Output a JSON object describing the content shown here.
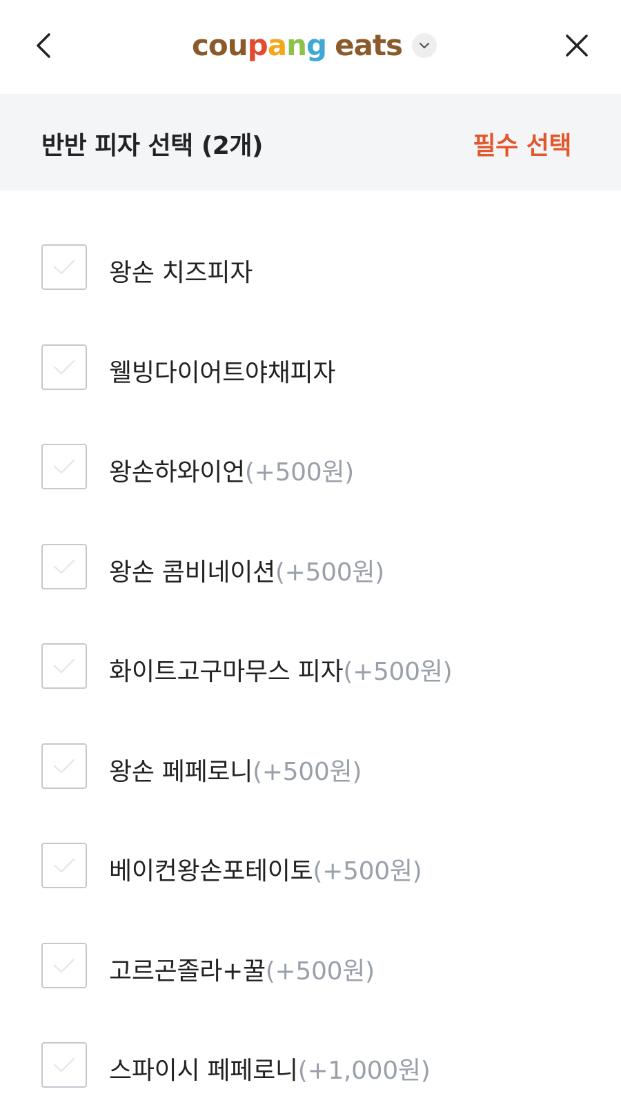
{
  "header": {
    "logo_letters": [
      {
        "char": "c",
        "color": "#8b5a2b"
      },
      {
        "char": "o",
        "color": "#8b5a2b"
      },
      {
        "char": "u",
        "color": "#8b5a2b"
      },
      {
        "char": "p",
        "color": "#e24b2f"
      },
      {
        "char": "a",
        "color": "#f2a81d"
      },
      {
        "char": "n",
        "color": "#8bc34a"
      },
      {
        "char": "g",
        "color": "#3fa9d6"
      },
      {
        "char": " ",
        "color": "#8b5a2b"
      },
      {
        "char": "e",
        "color": "#8b5a2b"
      },
      {
        "char": "a",
        "color": "#8b5a2b"
      },
      {
        "char": "t",
        "color": "#8b5a2b"
      },
      {
        "char": "s",
        "color": "#8b5a2b"
      }
    ],
    "back_icon": "chevron-left-icon",
    "close_icon": "close-icon",
    "switch_icon": "chevron-down-icon"
  },
  "section": {
    "title": "반반 피자 선택 (2개)",
    "required_label": "필수 선택",
    "required_color": "#e2572b"
  },
  "options": [
    {
      "name": "왕손 치즈피자",
      "price": "",
      "checked": false
    },
    {
      "name": "웰빙다이어트야채피자",
      "price": "",
      "checked": false
    },
    {
      "name": "왕손하와이언",
      "price": "(+500원)",
      "checked": false
    },
    {
      "name": "왕손 콤비네이션",
      "price": "(+500원)",
      "checked": false
    },
    {
      "name": "화이트고구마무스 피자",
      "price": "(+500원)",
      "checked": false
    },
    {
      "name": "왕손 페페로니",
      "price": "(+500원)",
      "checked": false
    },
    {
      "name": "베이컨왕손포테이토",
      "price": "(+500원)",
      "checked": false
    },
    {
      "name": "고르곤졸라+꿀",
      "price": "(+500원)",
      "checked": false
    },
    {
      "name": "스파이시 페페로니",
      "price": "(+1,000원)",
      "checked": false
    }
  ]
}
